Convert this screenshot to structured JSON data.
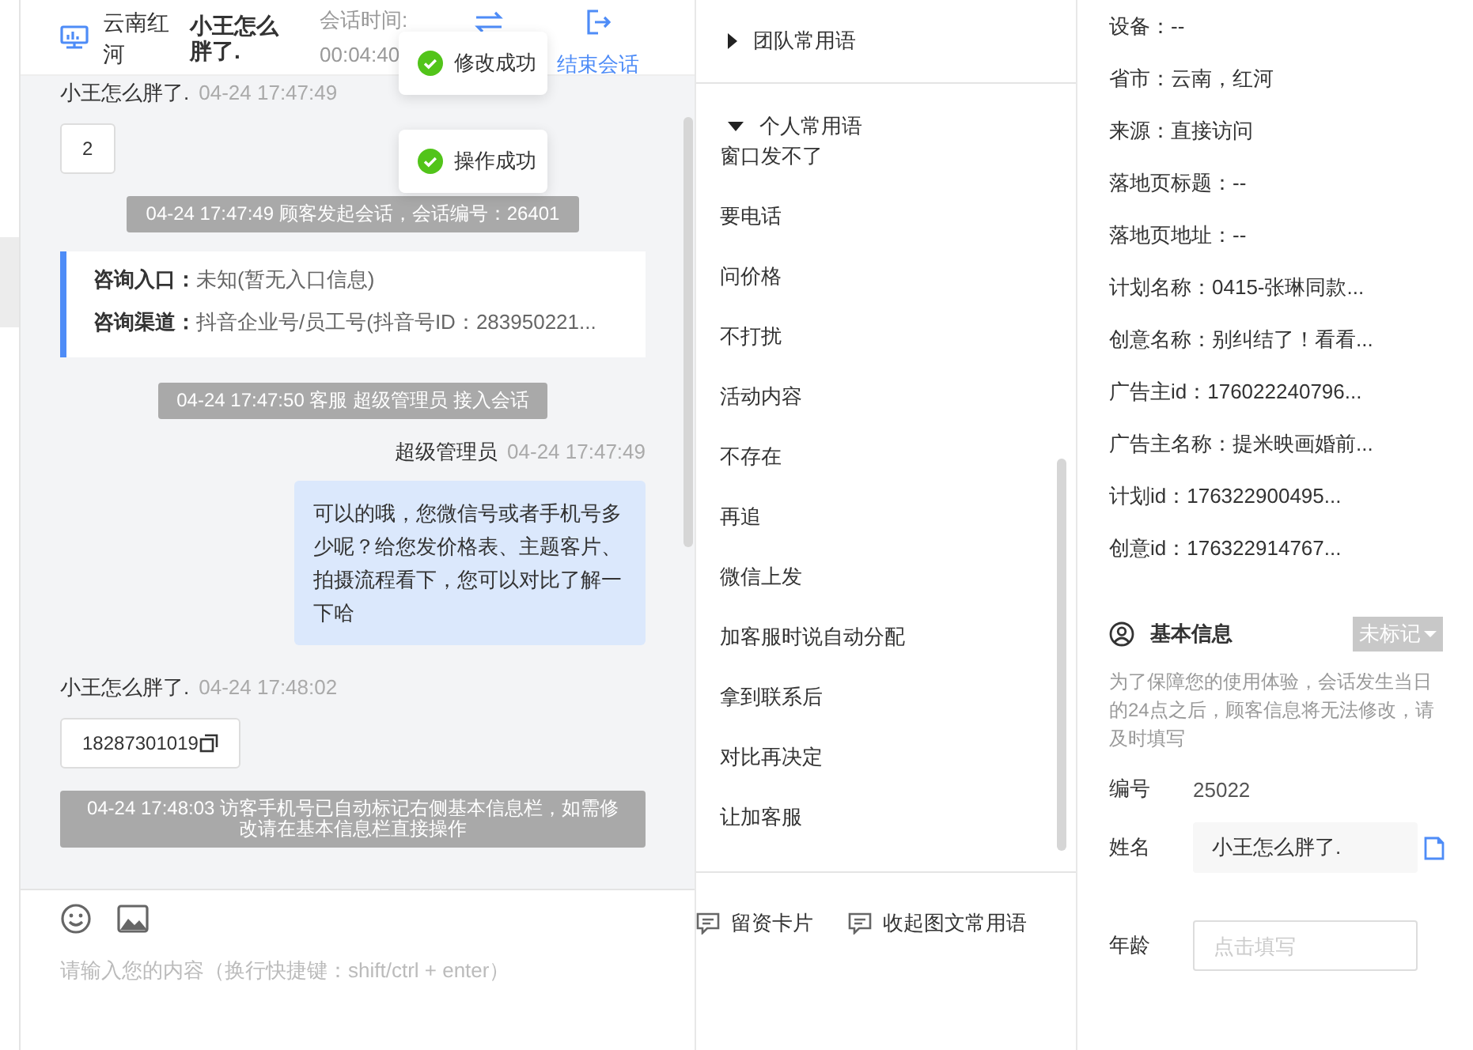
{
  "header": {
    "location": "云南红河",
    "name": "小王怎么胖了.",
    "time_label": "会话时间:",
    "time": "00:04:40",
    "end_label": "结束会话"
  },
  "toasts": [
    "修改成功",
    "操作成功"
  ],
  "messages": [
    {
      "kind": "visitor",
      "name": "小王怎么胖了.",
      "time": "04-24 17:47:49",
      "text": "2",
      "copy": false
    },
    {
      "kind": "system",
      "text": "04-24 17:47:49 顾客发起会话，会话编号：26401"
    },
    {
      "kind": "source_card",
      "rows": [
        {
          "label": "咨询入口：",
          "value": "未知(暂无入口信息)"
        },
        {
          "label": "咨询渠道：",
          "value": "抖音企业号/员工号(抖音号ID：283950221..."
        }
      ]
    },
    {
      "kind": "system",
      "text": "04-24 17:47:50 客服 超级管理员 接入会话"
    },
    {
      "kind": "agent",
      "name": "超级管理员",
      "time": "04-24 17:47:49",
      "text": "可以的哦，您微信号或者手机号多少呢？给您发价格表、主题客片、拍摄流程看下，您可以对比了解一下哈"
    },
    {
      "kind": "visitor",
      "name": "小王怎么胖了.",
      "time": "04-24 17:48:02",
      "text": "18287301019",
      "copy": true
    },
    {
      "kind": "system",
      "text": "04-24 17:48:03 访客手机号已自动标记右侧基本信息栏，如需修改请在基本信息栏直接操作"
    }
  ],
  "input": {
    "placeholder": "请输入您的内容（换行快捷键：shift/ctrl + enter）"
  },
  "quick_replies": {
    "groups": [
      {
        "title": "团队常用语",
        "expanded": false
      },
      {
        "title": "个人常用语",
        "expanded": true,
        "items": [
          "窗口发不了",
          "要电话",
          "问价格",
          "不打扰",
          "活动内容",
          "不存在",
          "再追",
          "微信上发",
          "加客服时说自动分配",
          "拿到联系后",
          "对比再决定",
          "让加客服"
        ]
      }
    ],
    "buttons": [
      "留资卡片",
      "收起图文常用语"
    ]
  },
  "info": {
    "rows": [
      "设备：--",
      "省市：云南，红河",
      "来源：直接访问",
      "落地页标题：--",
      "落地页地址：--",
      "计划名称：0415-张琳同款...",
      "创意名称：别纠结了！看看...",
      "广告主id：176022240796...",
      "广告主名称：提米映画婚前...",
      "计划id：176322900495...",
      "创意id：176322914767..."
    ],
    "basic": {
      "title": "基本信息",
      "tag": "未标记",
      "notice": "为了保障您的使用体验，会话发生当日的24点之后，顾客信息将无法修改，请及时填写",
      "fields": [
        {
          "kind": "text",
          "label": "编号",
          "value": "25022"
        },
        {
          "kind": "filled",
          "label": "姓名",
          "value": "小王怎么胖了."
        },
        {
          "kind": "input",
          "label": "年龄",
          "placeholder": "点击填写"
        }
      ]
    }
  }
}
